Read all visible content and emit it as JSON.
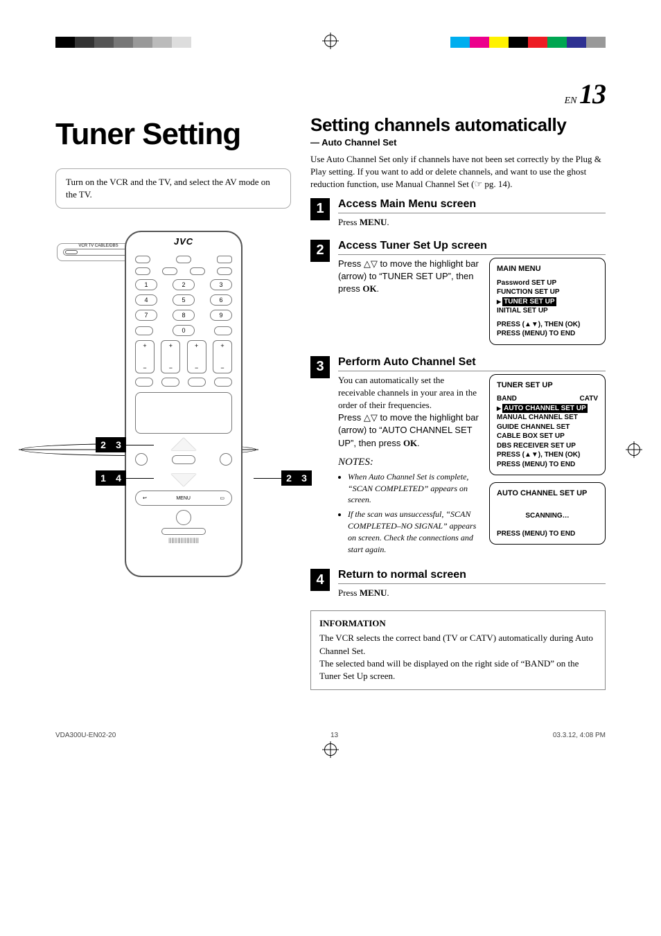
{
  "page": {
    "lang": "EN",
    "number": "13"
  },
  "title": "Tuner Setting",
  "instructionBox": "Turn on the VCR and the TV, and select the AV mode on the TV.",
  "remote": {
    "brand": "JVC",
    "switchLabel": "VCR   TV CABLE/DBS",
    "numbers": [
      "1",
      "2",
      "3",
      "4",
      "5",
      "6",
      "7",
      "8",
      "9",
      "0"
    ],
    "menuBar": [
      "",
      "MENU",
      ""
    ]
  },
  "callouts": {
    "leftTop": [
      "2",
      "3"
    ],
    "leftBottom": [
      "1",
      "4"
    ],
    "right": [
      "2",
      "3"
    ]
  },
  "rightCol": {
    "heading": "Setting channels automatically",
    "subheading": "— Auto Channel Set",
    "intro": "Use Auto Channel Set only if channels have not been set correctly by the Plug & Play setting. If you want to add or delete channels, and want to use the ghost reduction function, use Manual Channel Set (☞ pg. 14).",
    "steps": [
      {
        "n": "1",
        "title": "Access Main Menu screen",
        "text_before": "Press ",
        "text_bold": "MENU",
        "text_after": "."
      },
      {
        "n": "2",
        "title": "Access Tuner Set Up screen",
        "text": "Press △▽ to move the highlight bar (arrow) to “TUNER SET UP”, then press ",
        "text_bold": "OK",
        "text_after": ".",
        "osd": {
          "title": "MAIN MENU",
          "lines": [
            "Password SET UP",
            "FUNCTION SET UP"
          ],
          "highlight": "TUNER SET UP",
          "after": [
            "INITIAL SET UP"
          ],
          "footer": [
            "PRESS (▲▼), THEN (OK)",
            "PRESS (MENU) TO END"
          ]
        }
      },
      {
        "n": "3",
        "title": "Perform Auto Channel Set",
        "text1": "You can automatically set the receivable channels in your area in the order of their frequencies.",
        "text2a": "Press △▽ to move the highlight bar (arrow) to “AUTO CHANNEL SET UP”, then press ",
        "text2b": "OK",
        "text2c": ".",
        "osd1": {
          "title": "TUNER SET UP",
          "bandLabel": "BAND",
          "bandValue": "CATV",
          "highlight": "AUTO CHANNEL SET UP",
          "after": [
            "MANUAL CHANNEL SET",
            "GUIDE CHANNEL SET",
            "CABLE BOX SET UP",
            "DBS RECEIVER SET UP"
          ],
          "footer": [
            "PRESS (▲▼), THEN (OK)",
            "PRESS (MENU) TO END"
          ]
        },
        "osd2": {
          "title": "AUTO CHANNEL SET UP",
          "mid": "SCANNING…",
          "footer": "PRESS (MENU) TO END"
        },
        "notesHeading": "NOTES:",
        "notes": [
          "When Auto Channel Set is complete, “SCAN COMPLETED” appears on screen.",
          "If the scan was unsuccessful, “SCAN COMPLETED–NO SIGNAL” appears on screen. Check the connections and start again."
        ]
      },
      {
        "n": "4",
        "title": "Return to normal screen",
        "text_before": "Press ",
        "text_bold": "MENU",
        "text_after": "."
      }
    ],
    "info": {
      "heading": "INFORMATION",
      "text": "The VCR selects the correct band (TV or CATV) automatically during Auto Channel Set.\nThe selected band will be displayed on the right side of “BAND” on the Tuner Set Up screen."
    }
  },
  "footer": {
    "left": "VDA300U-EN02-20",
    "center": "13",
    "right": "03.3.12, 4:08 PM"
  }
}
